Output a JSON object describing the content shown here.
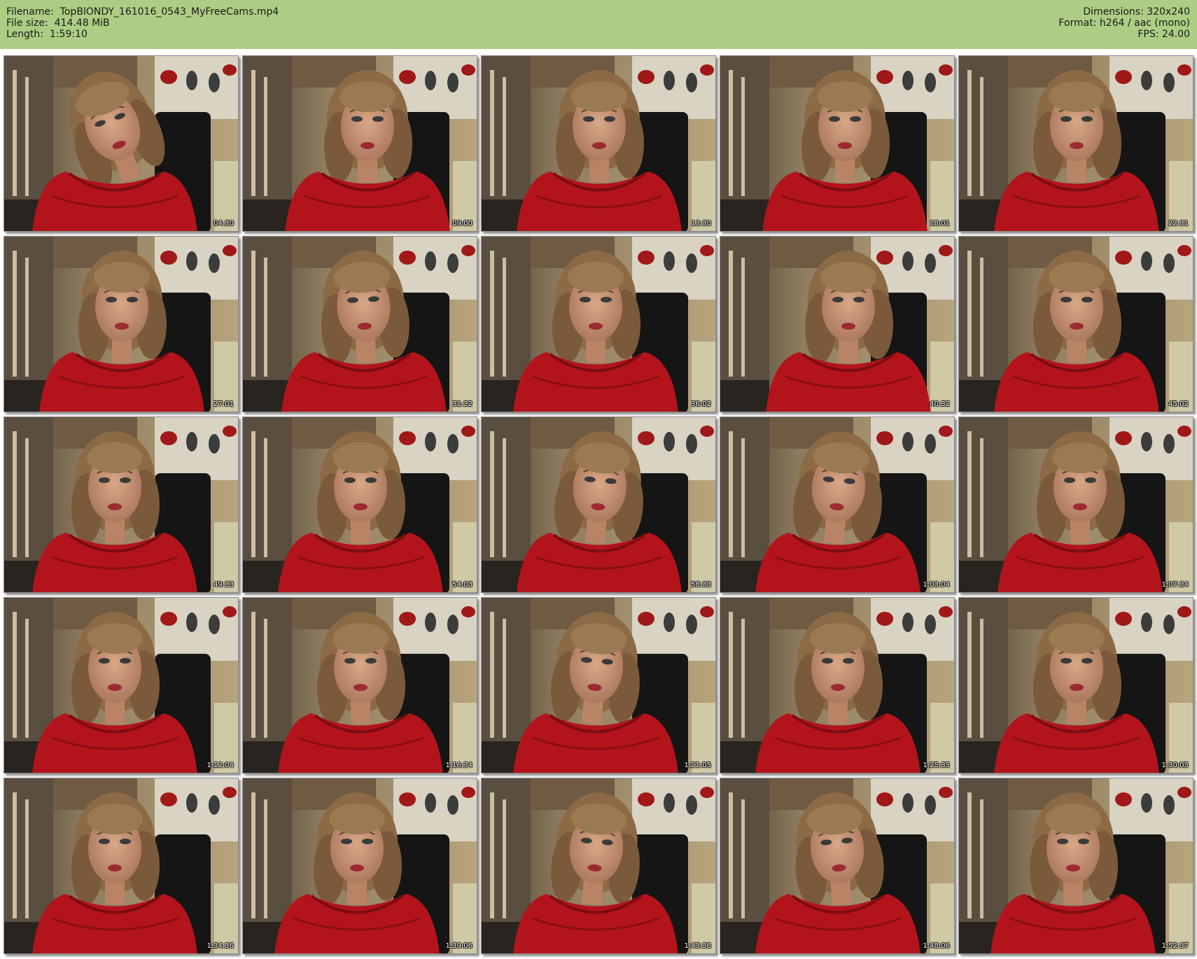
{
  "header": {
    "background": "#adcd84",
    "left_lines": [
      "Filename:  TopBlONDY_161016_0543_MyFreeCams.mp4",
      "File size:  414.48 MiB",
      "Length:  1:59:10"
    ],
    "right_lines": [
      "Dimensions: 320x240",
      "Format: h264 / aac (mono)",
      "FPS: 24.00"
    ]
  },
  "thumbnails": {
    "columns": 5,
    "rows": 5,
    "subject": "woman in red off-shoulder top, webcam frame",
    "timestamps": [
      "04:30",
      "09:00",
      "13:30",
      "18:01",
      "22:31",
      "27:01",
      "31:32",
      "36:02",
      "40:32",
      "45:02",
      "49:33",
      "54:03",
      "58:33",
      "1:03:04",
      "1:07:34",
      "1:12:04",
      "1:16:34",
      "1:21:05",
      "1:25:35",
      "1:30:05",
      "1:34:36",
      "1:39:06",
      "1:43:36",
      "1:48:06",
      "1:52:37"
    ]
  }
}
